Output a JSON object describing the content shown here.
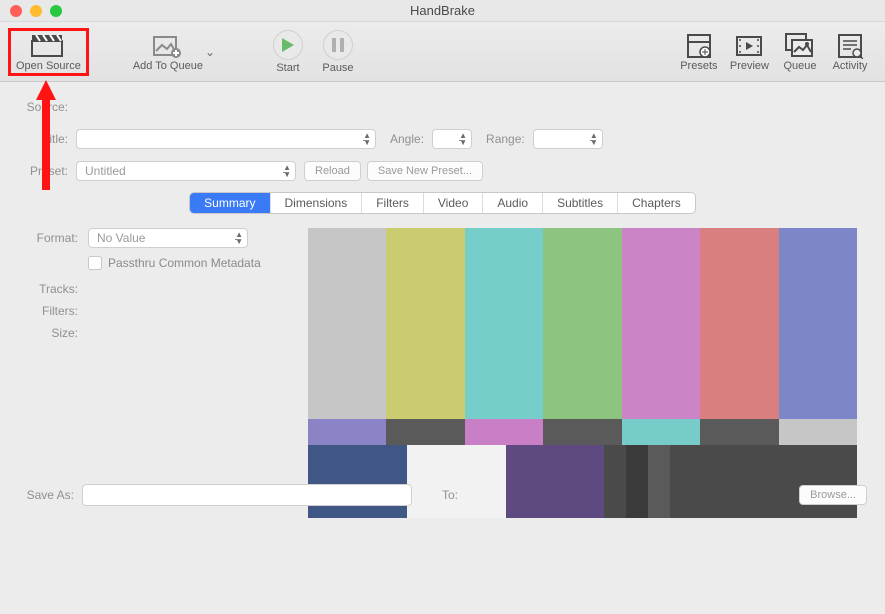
{
  "window": {
    "title": "HandBrake"
  },
  "toolbar": {
    "open_source": "Open Source",
    "add_queue": "Add To Queue",
    "start": "Start",
    "pause": "Pause",
    "presets": "Presets",
    "preview": "Preview",
    "queue": "Queue",
    "activity": "Activity"
  },
  "form": {
    "source_label": "Source:",
    "title_label": "Title:",
    "angle_label": "Angle:",
    "range_label": "Range:",
    "preset_label": "Preset:",
    "preset_value": "Untitled",
    "reload": "Reload",
    "save_new_preset": "Save New Preset..."
  },
  "tabs": [
    "Summary",
    "Dimensions",
    "Filters",
    "Video",
    "Audio",
    "Subtitles",
    "Chapters"
  ],
  "active_tab": "Summary",
  "summary": {
    "format_label": "Format:",
    "format_value": "No Value",
    "passthru": "Passthru Common Metadata",
    "tracks_label": "Tracks:",
    "filters_label": "Filters:",
    "size_label": "Size:"
  },
  "footer": {
    "save_as": "Save As:",
    "to": "To:",
    "browse": "Browse..."
  },
  "colorbars": {
    "row1": [
      "#c6c6c6",
      "#cbcb70",
      "#75ceca",
      "#8dc47f",
      "#cb85c7",
      "#d97f7f",
      "#7c86c9"
    ],
    "row2": [
      "#8a84c6",
      "#5a5a5a",
      "#c97fc5",
      "#5a5a5a",
      "#77cbc8",
      "#5a5a5a",
      "#c6c6c6"
    ],
    "row3w": [
      18,
      18,
      18,
      4,
      4,
      4,
      17,
      17
    ],
    "row3": [
      "#405684",
      "#f2f2f2",
      "#5e4a80",
      "#4a4a4a",
      "#3b3b3b",
      "#5a5a5a",
      "#4a4a4a",
      "#4a4a4a"
    ]
  }
}
